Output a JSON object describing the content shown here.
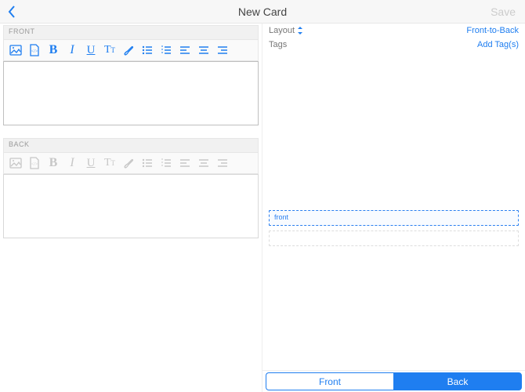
{
  "header": {
    "title": "New Card",
    "save_label": "Save"
  },
  "editors": {
    "front_label": "FRONT",
    "back_label": "BACK"
  },
  "meta": {
    "layout_key": "Layout",
    "layout_value": "Front-to-Back",
    "tags_key": "Tags",
    "tags_value": "Add Tag(s)"
  },
  "preview": {
    "front_slot": "front",
    "back_slot": ""
  },
  "segbar": {
    "front_label": "Front",
    "back_label": "Back"
  },
  "colors": {
    "accent": "#1f7ef0",
    "disabled": "#c7c7c7"
  }
}
